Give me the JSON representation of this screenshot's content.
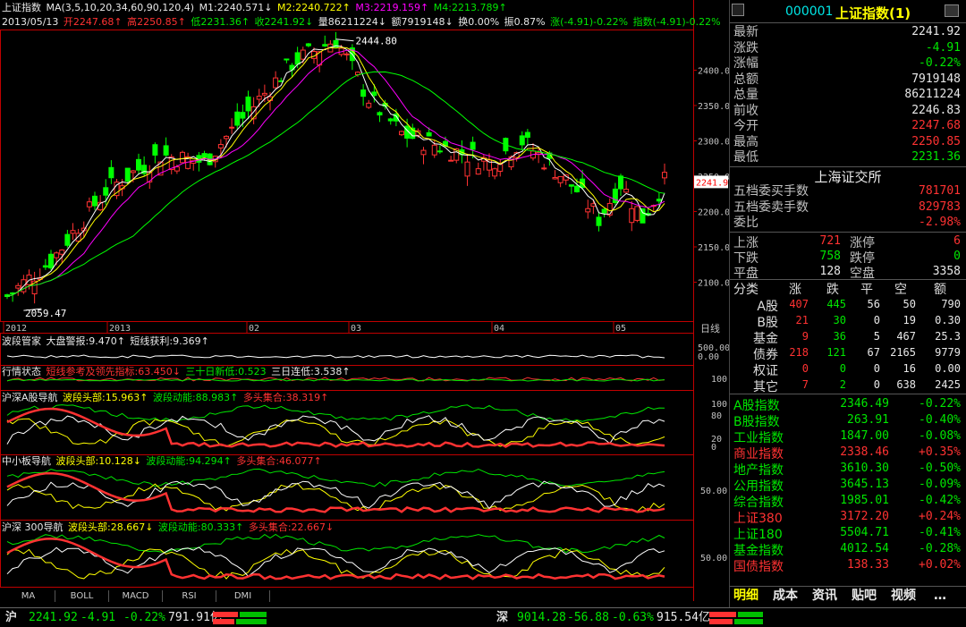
{
  "header": {
    "index_name": "上证指数",
    "ma_label": "MA(3,5,10,20,34,60,90,120,4)",
    "m1": "M1:2240.571↓",
    "m2": "M2:2240.722↑",
    "m3": "M3:2219.159↑",
    "m4": "M4:2213.789↑",
    "date": "2013/05/13",
    "open": "开2247.68↑",
    "high": "高2250.85↑",
    "low": "低2231.36↑",
    "close": "收2241.92↓",
    "volume": "量86211224↓",
    "amount": "额7919148↓",
    "turnover": "换0.00%",
    "amplitude": "振0.87%",
    "change": "涨(-4.91)-0.22%",
    "index_change": "指数(-4.91)-0.22%"
  },
  "price_axis": {
    "labels": [
      "2400.0",
      "2350.0",
      "2300.0",
      "2250.0",
      "2200.0",
      "2150.0",
      "2100.0"
    ],
    "current": "2241.9",
    "high_mark": "2444.80",
    "low_mark": "2059.47"
  },
  "time_axis": {
    "labels": [
      "2012",
      "2013",
      "02",
      "03",
      "04",
      "05"
    ],
    "period": "日线"
  },
  "panels": {
    "p1": {
      "title": "波段管家",
      "a": "大盘警报:9.470↑",
      "b": "短线获利:9.369↑",
      "axis": [
        "500.00",
        "0.00"
      ]
    },
    "p2": {
      "title": "行情状态",
      "a": "短线参考及领先指标:63.450↓",
      "b": "三十日新低:0.523",
      "c": "三日连低:3.538↑",
      "axis": [
        "100"
      ]
    },
    "p3": {
      "title": "沪深A股导航",
      "a": "波段头部:15.963↑",
      "b": "波段动能:88.983↑",
      "c": "多头集合:38.319↑",
      "axis": [
        "100",
        "80",
        "20",
        "0"
      ]
    },
    "p4": {
      "title": "中小板导航",
      "a": "波段头部:10.128↓",
      "b": "波段动能:94.294↑",
      "c": "多头集合:46.077↑",
      "axis": [
        "50.00"
      ]
    },
    "p5": {
      "title": "沪深 300导航",
      "a": "波段头部:28.667↓",
      "b": "波段动能:80.333↑",
      "c": "多头集合:22.667↓",
      "axis": [
        "50.00"
      ]
    }
  },
  "indicator_tabs": [
    "MA",
    "BOLL",
    "MACD",
    "RSI",
    "DMI"
  ],
  "quote": {
    "code": "000001",
    "name": "上证指数(1)",
    "rows": [
      {
        "label": "最新",
        "value": "2241.92",
        "color": "#e8e8e8"
      },
      {
        "label": "涨跌",
        "value": "-4.91",
        "color": "#00e600"
      },
      {
        "label": "涨幅",
        "value": "-0.22%",
        "color": "#00e600"
      },
      {
        "label": "总额",
        "value": "7919148",
        "color": "#e8e8e8"
      },
      {
        "label": "总量",
        "value": "86211224",
        "color": "#e8e8e8"
      },
      {
        "label": "前收",
        "value": "2246.83",
        "color": "#e8e8e8"
      },
      {
        "label": "今开",
        "value": "2247.68",
        "color": "#ff3232"
      },
      {
        "label": "最高",
        "value": "2250.85",
        "color": "#ff3232"
      },
      {
        "label": "最低",
        "value": "2231.36",
        "color": "#00e600"
      }
    ],
    "exchange": "上海证交所",
    "order_rows": [
      {
        "label": "五档委买手数",
        "value": "781701",
        "color": "#ff3232"
      },
      {
        "label": "五档委卖手数",
        "value": "829783",
        "color": "#ff3232"
      },
      {
        "label": "委比",
        "value": "-2.98%",
        "color": "#ff3232"
      }
    ],
    "breadth": {
      "up_label": "上涨",
      "up": "721",
      "limit_up_label": "涨停",
      "limit_up": "6",
      "down_label": "下跌",
      "down": "758",
      "limit_down_label": "跌停",
      "limit_down": "0",
      "flat_label": "平盘",
      "flat": "128",
      "empty_label": "空盘",
      "empty": "3358"
    },
    "category_headers": [
      "分类",
      "涨",
      "跌",
      "平",
      "空",
      "额"
    ],
    "categories": [
      [
        "A股",
        "407",
        "445",
        "56",
        "50",
        "790"
      ],
      [
        "B股",
        "21",
        "30",
        "0",
        "19",
        "0.30"
      ],
      [
        "基金",
        "9",
        "36",
        "5",
        "467",
        "25.3"
      ],
      [
        "债券",
        "218",
        "121",
        "67",
        "2165",
        "9779"
      ],
      [
        "权证",
        "0",
        "0",
        "0",
        "16",
        "0.00"
      ],
      [
        "其它",
        "7",
        "2",
        "0",
        "638",
        "2425"
      ]
    ],
    "indices": [
      {
        "name": "A股指数",
        "value": "2346.49",
        "chg": "-0.22%",
        "color": "#00e600"
      },
      {
        "name": "B股指数",
        "value": "263.91",
        "chg": "-0.40%",
        "color": "#00e600"
      },
      {
        "name": "工业指数",
        "value": "1847.00",
        "chg": "-0.08%",
        "color": "#00e600"
      },
      {
        "name": "商业指数",
        "value": "2338.46",
        "chg": "+0.35%",
        "color": "#ff3232"
      },
      {
        "name": "地产指数",
        "value": "3610.30",
        "chg": "-0.50%",
        "color": "#00e600"
      },
      {
        "name": "公用指数",
        "value": "3645.13",
        "chg": "-0.09%",
        "color": "#00e600"
      },
      {
        "name": "综合指数",
        "value": "1985.01",
        "chg": "-0.42%",
        "color": "#00e600"
      },
      {
        "name": "上证380",
        "value": "3172.20",
        "chg": "+0.24%",
        "color": "#ff3232"
      },
      {
        "name": "上证180",
        "value": "5504.71",
        "chg": "-0.41%",
        "color": "#00e600"
      },
      {
        "name": "基金指数",
        "value": "4012.54",
        "chg": "-0.28%",
        "color": "#00e600"
      },
      {
        "name": "国债指数",
        "value": "138.33",
        "chg": "+0.02%",
        "color": "#ff3232"
      }
    ],
    "tabs": [
      "明细",
      "成本",
      "资讯",
      "贴吧",
      "视频",
      "…"
    ]
  },
  "status_bar": {
    "sh_label": "沪",
    "sh_value": "2241.92",
    "sh_change": "-4.91",
    "sh_pct": "-0.22%",
    "sh_amount": "791.91亿",
    "sz_label": "深",
    "sz_value": "9014.28",
    "sz_change": "-56.88",
    "sz_pct": "-0.63%",
    "sz_amount": "915.54亿"
  },
  "colors": {
    "up": "#ff3232",
    "down": "#00e600",
    "ma1": "#ffffff",
    "ma2": "#ffff00",
    "ma3": "#ff00ff",
    "ma4": "#00ff00",
    "axis": "#c00000"
  }
}
